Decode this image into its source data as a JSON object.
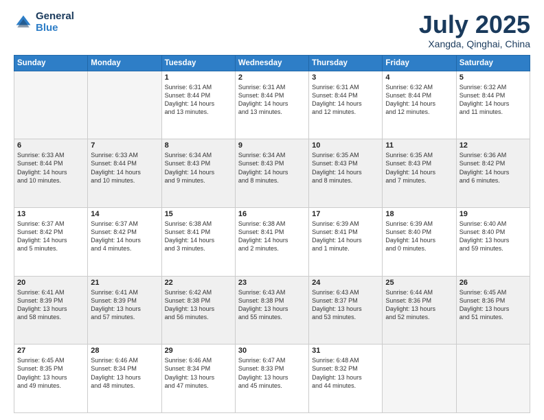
{
  "logo": {
    "general": "General",
    "blue": "Blue"
  },
  "title": {
    "month": "July 2025",
    "location": "Xangda, Qinghai, China"
  },
  "days_of_week": [
    "Sunday",
    "Monday",
    "Tuesday",
    "Wednesday",
    "Thursday",
    "Friday",
    "Saturday"
  ],
  "weeks": [
    [
      {
        "num": "",
        "info": ""
      },
      {
        "num": "",
        "info": ""
      },
      {
        "num": "1",
        "info": "Sunrise: 6:31 AM\nSunset: 8:44 PM\nDaylight: 14 hours\nand 13 minutes."
      },
      {
        "num": "2",
        "info": "Sunrise: 6:31 AM\nSunset: 8:44 PM\nDaylight: 14 hours\nand 13 minutes."
      },
      {
        "num": "3",
        "info": "Sunrise: 6:31 AM\nSunset: 8:44 PM\nDaylight: 14 hours\nand 12 minutes."
      },
      {
        "num": "4",
        "info": "Sunrise: 6:32 AM\nSunset: 8:44 PM\nDaylight: 14 hours\nand 12 minutes."
      },
      {
        "num": "5",
        "info": "Sunrise: 6:32 AM\nSunset: 8:44 PM\nDaylight: 14 hours\nand 11 minutes."
      }
    ],
    [
      {
        "num": "6",
        "info": "Sunrise: 6:33 AM\nSunset: 8:44 PM\nDaylight: 14 hours\nand 10 minutes."
      },
      {
        "num": "7",
        "info": "Sunrise: 6:33 AM\nSunset: 8:44 PM\nDaylight: 14 hours\nand 10 minutes."
      },
      {
        "num": "8",
        "info": "Sunrise: 6:34 AM\nSunset: 8:43 PM\nDaylight: 14 hours\nand 9 minutes."
      },
      {
        "num": "9",
        "info": "Sunrise: 6:34 AM\nSunset: 8:43 PM\nDaylight: 14 hours\nand 8 minutes."
      },
      {
        "num": "10",
        "info": "Sunrise: 6:35 AM\nSunset: 8:43 PM\nDaylight: 14 hours\nand 8 minutes."
      },
      {
        "num": "11",
        "info": "Sunrise: 6:35 AM\nSunset: 8:43 PM\nDaylight: 14 hours\nand 7 minutes."
      },
      {
        "num": "12",
        "info": "Sunrise: 6:36 AM\nSunset: 8:42 PM\nDaylight: 14 hours\nand 6 minutes."
      }
    ],
    [
      {
        "num": "13",
        "info": "Sunrise: 6:37 AM\nSunset: 8:42 PM\nDaylight: 14 hours\nand 5 minutes."
      },
      {
        "num": "14",
        "info": "Sunrise: 6:37 AM\nSunset: 8:42 PM\nDaylight: 14 hours\nand 4 minutes."
      },
      {
        "num": "15",
        "info": "Sunrise: 6:38 AM\nSunset: 8:41 PM\nDaylight: 14 hours\nand 3 minutes."
      },
      {
        "num": "16",
        "info": "Sunrise: 6:38 AM\nSunset: 8:41 PM\nDaylight: 14 hours\nand 2 minutes."
      },
      {
        "num": "17",
        "info": "Sunrise: 6:39 AM\nSunset: 8:41 PM\nDaylight: 14 hours\nand 1 minute."
      },
      {
        "num": "18",
        "info": "Sunrise: 6:39 AM\nSunset: 8:40 PM\nDaylight: 14 hours\nand 0 minutes."
      },
      {
        "num": "19",
        "info": "Sunrise: 6:40 AM\nSunset: 8:40 PM\nDaylight: 13 hours\nand 59 minutes."
      }
    ],
    [
      {
        "num": "20",
        "info": "Sunrise: 6:41 AM\nSunset: 8:39 PM\nDaylight: 13 hours\nand 58 minutes."
      },
      {
        "num": "21",
        "info": "Sunrise: 6:41 AM\nSunset: 8:39 PM\nDaylight: 13 hours\nand 57 minutes."
      },
      {
        "num": "22",
        "info": "Sunrise: 6:42 AM\nSunset: 8:38 PM\nDaylight: 13 hours\nand 56 minutes."
      },
      {
        "num": "23",
        "info": "Sunrise: 6:43 AM\nSunset: 8:38 PM\nDaylight: 13 hours\nand 55 minutes."
      },
      {
        "num": "24",
        "info": "Sunrise: 6:43 AM\nSunset: 8:37 PM\nDaylight: 13 hours\nand 53 minutes."
      },
      {
        "num": "25",
        "info": "Sunrise: 6:44 AM\nSunset: 8:36 PM\nDaylight: 13 hours\nand 52 minutes."
      },
      {
        "num": "26",
        "info": "Sunrise: 6:45 AM\nSunset: 8:36 PM\nDaylight: 13 hours\nand 51 minutes."
      }
    ],
    [
      {
        "num": "27",
        "info": "Sunrise: 6:45 AM\nSunset: 8:35 PM\nDaylight: 13 hours\nand 49 minutes."
      },
      {
        "num": "28",
        "info": "Sunrise: 6:46 AM\nSunset: 8:34 PM\nDaylight: 13 hours\nand 48 minutes."
      },
      {
        "num": "29",
        "info": "Sunrise: 6:46 AM\nSunset: 8:34 PM\nDaylight: 13 hours\nand 47 minutes."
      },
      {
        "num": "30",
        "info": "Sunrise: 6:47 AM\nSunset: 8:33 PM\nDaylight: 13 hours\nand 45 minutes."
      },
      {
        "num": "31",
        "info": "Sunrise: 6:48 AM\nSunset: 8:32 PM\nDaylight: 13 hours\nand 44 minutes."
      },
      {
        "num": "",
        "info": ""
      },
      {
        "num": "",
        "info": ""
      }
    ]
  ]
}
